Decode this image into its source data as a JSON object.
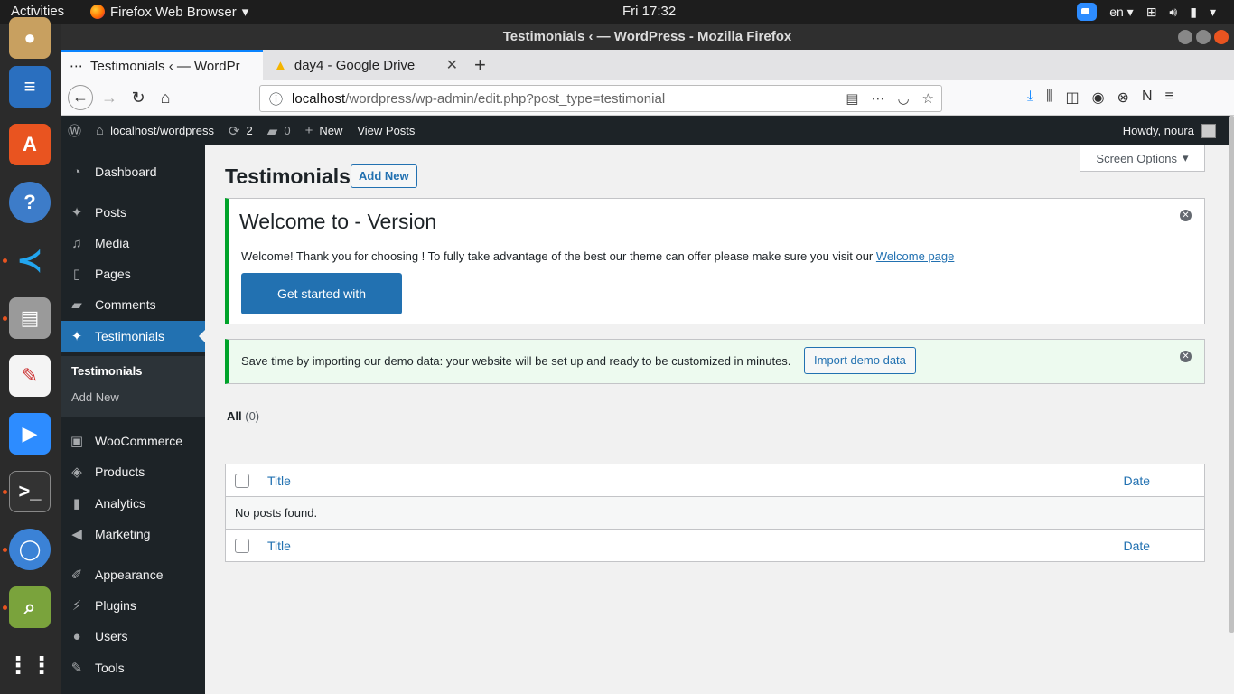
{
  "system": {
    "activities": "Activities",
    "app_menu": "Firefox Web Browser",
    "clock": "Fri 17:32",
    "language": "en",
    "dock": [
      "firefox",
      "text-editor",
      "software-center",
      "help",
      "vscode",
      "scanner",
      "gedit",
      "zoom",
      "terminal",
      "chromium",
      "image-viewer",
      "app-grid"
    ]
  },
  "browser": {
    "window_title": "Testimonials ‹ — WordPress - Mozilla Firefox",
    "tabs": [
      {
        "label": "Testimonials ‹ — WordPr",
        "active": true
      },
      {
        "label": "day4 - Google Drive",
        "active": false
      }
    ],
    "url_host": "localhost",
    "url_path": "/wordpress/wp-admin/edit.php?post_type=testimonial"
  },
  "adminbar": {
    "site": "localhost/wordpress",
    "updates": "2",
    "comments": "0",
    "new": "New",
    "view_posts": "View Posts",
    "howdy": "Howdy, noura"
  },
  "sidebar": {
    "items": [
      {
        "label": "Dashboard",
        "icon": "dashboard-icon"
      },
      {
        "label": "Posts",
        "icon": "pin-icon"
      },
      {
        "label": "Media",
        "icon": "media-icon"
      },
      {
        "label": "Pages",
        "icon": "pages-icon"
      },
      {
        "label": "Comments",
        "icon": "comment-icon"
      },
      {
        "label": "Testimonials",
        "icon": "pin-icon"
      },
      {
        "label": "WooCommerce",
        "icon": "woo-icon"
      },
      {
        "label": "Products",
        "icon": "box-icon"
      },
      {
        "label": "Analytics",
        "icon": "chart-icon"
      },
      {
        "label": "Marketing",
        "icon": "megaphone-icon"
      },
      {
        "label": "Appearance",
        "icon": "brush-icon"
      },
      {
        "label": "Plugins",
        "icon": "plug-icon"
      },
      {
        "label": "Users",
        "icon": "user-icon"
      },
      {
        "label": "Tools",
        "icon": "wrench-icon"
      }
    ],
    "submenu": [
      "Testimonials",
      "Add New"
    ]
  },
  "main": {
    "title": "Testimonials",
    "add_new": "Add New",
    "screen_options": "Screen Options",
    "welcome": {
      "heading": "Welcome to - Version",
      "text": "Welcome! Thank you for choosing ! To fully take advantage of the best our theme can offer please make sure you visit our",
      "link": "Welcome page",
      "button": "Get started with"
    },
    "demo": {
      "text": "Save time by importing our demo data: your website will be set up and ready to be customized in minutes.",
      "button": "Import demo data"
    },
    "filter_all": "All",
    "filter_count": "(0)",
    "table": {
      "col_title": "Title",
      "col_date": "Date",
      "empty": "No posts found."
    }
  },
  "colors": {
    "wp_dark": "#1d2327",
    "wp_blue": "#2271b1",
    "notice_green": "#00a32a"
  }
}
